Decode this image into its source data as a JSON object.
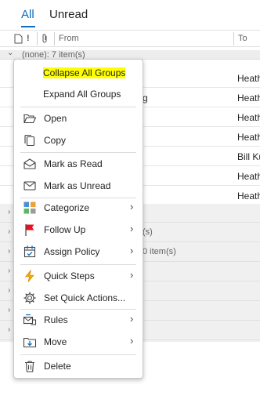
{
  "tabs": {
    "all": "All",
    "unread": "Unread"
  },
  "columns": {
    "from": "From",
    "to": "To"
  },
  "list": {
    "first_group": "(none): 7 item(s)",
    "from_values": [
      "Heath",
      "Heath",
      "Heath",
      "Heath",
      "Bill Ku",
      "Heath",
      "Heath"
    ],
    "frag_g": "g",
    "frag_s": "(s)",
    "frag_0": "0 item(s)"
  },
  "menu": {
    "items": [
      {
        "label": "Collapse All Groups",
        "highlight": "#ffff00"
      },
      {
        "label": "Expand All Groups"
      },
      {
        "label": "Open",
        "icon": "folder-open-icon"
      },
      {
        "label": "Copy",
        "icon": "copy-icon"
      },
      {
        "label": "Mark as Read",
        "icon": "envelope-open-icon"
      },
      {
        "label": "Mark as Unread",
        "icon": "envelope-icon"
      },
      {
        "label": "Categorize",
        "icon": "categorize-icon"
      },
      {
        "label": "Follow Up",
        "icon": "flag-icon"
      },
      {
        "label": "Assign Policy",
        "icon": "policy-icon"
      },
      {
        "label": "Quick Steps",
        "icon": "lightning-icon"
      },
      {
        "label": "Set Quick Actions...",
        "icon": "gear-icon"
      },
      {
        "label": "Rules",
        "icon": "rules-icon"
      },
      {
        "label": "Move",
        "icon": "move-icon"
      },
      {
        "label": "Delete",
        "icon": "trash-icon"
      }
    ]
  },
  "colors": {
    "accent": "#0f6cbd",
    "highlight": "#ffff00",
    "flag": "#e81123",
    "lightning": "#f7a800"
  }
}
